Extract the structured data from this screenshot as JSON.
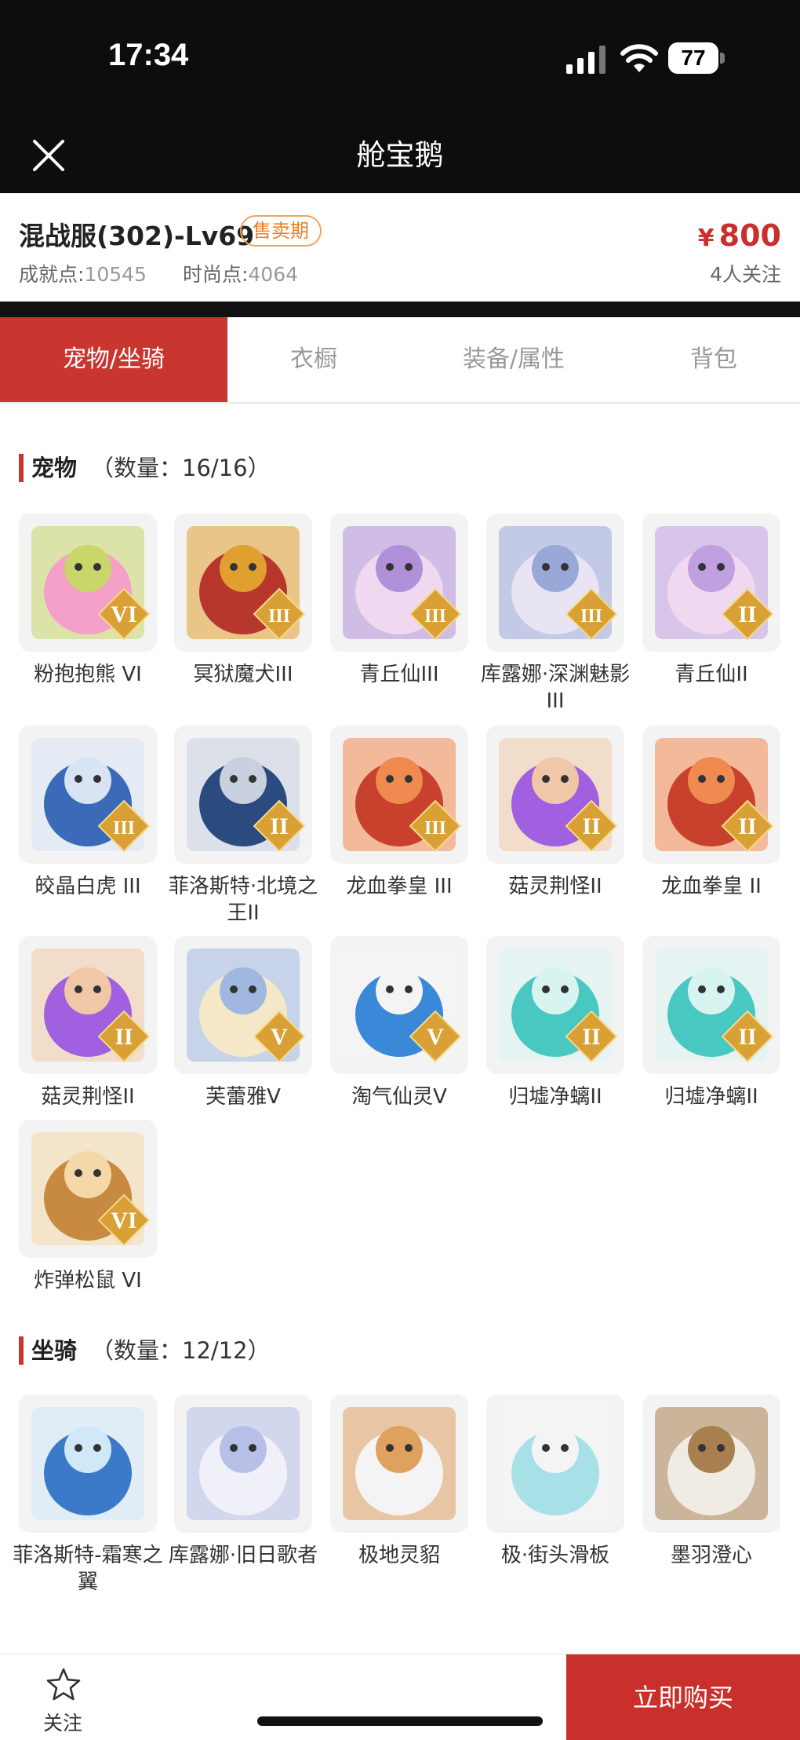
{
  "status_bar": {
    "time": "17:34",
    "battery": "77"
  },
  "nav": {
    "title": "舱宝鹅"
  },
  "listing": {
    "title": "混战服(302)-Lv69",
    "badge": "售卖期",
    "achievement_label": "成就点:",
    "achievement_value": "10545",
    "fashion_label": "时尚点:",
    "fashion_value": "4064",
    "currency": "¥",
    "price": "800",
    "followers": "4人关注"
  },
  "tabs": [
    {
      "label": "宠物/坐骑",
      "active": true
    },
    {
      "label": "衣橱",
      "active": false
    },
    {
      "label": "装备/属性",
      "active": false
    },
    {
      "label": "背包",
      "active": false
    }
  ],
  "pets_section": {
    "title": "宠物",
    "count": "（数量：16/16）"
  },
  "pets": [
    {
      "name": "粉抱抱熊 VI",
      "rank": "VI"
    },
    {
      "name": "冥狱魔犬III",
      "rank": "III"
    },
    {
      "name": "青丘仙III",
      "rank": "III"
    },
    {
      "name": "库露娜·深渊魅影III",
      "rank": "III"
    },
    {
      "name": "青丘仙II",
      "rank": "II"
    },
    {
      "name": "皎晶白虎 III",
      "rank": "III"
    },
    {
      "name": "菲洛斯特·北境之王II",
      "rank": "II"
    },
    {
      "name": "龙血拳皇 III",
      "rank": "III"
    },
    {
      "name": "菇灵荆怪II",
      "rank": "II"
    },
    {
      "name": "龙血拳皇 II",
      "rank": "II"
    },
    {
      "name": "菇灵荆怪II",
      "rank": "II"
    },
    {
      "name": "芙蕾雅V",
      "rank": "V"
    },
    {
      "name": "淘气仙灵V",
      "rank": "V"
    },
    {
      "name": "归墟净螭II",
      "rank": "II"
    },
    {
      "name": "归墟净螭II",
      "rank": "II"
    },
    {
      "name": "炸弹松鼠 VI",
      "rank": "VI"
    }
  ],
  "mounts_section": {
    "title": "坐骑",
    "count": "（数量：12/12）"
  },
  "mounts": [
    {
      "name": "菲洛斯特-霜寒之翼"
    },
    {
      "name": "库露娜·旧日歌者"
    },
    {
      "name": "极地灵貂"
    },
    {
      "name": "极·街头滑板"
    },
    {
      "name": "墨羽澄心"
    }
  ],
  "bottom_bar": {
    "follow_label": "关注",
    "buy_label": "立即购买"
  },
  "colors": {
    "accent": "#c9302c",
    "badge": "#ee7f26",
    "nav_bg": "#0d0d0d",
    "rank_badge": "#d9a035"
  }
}
